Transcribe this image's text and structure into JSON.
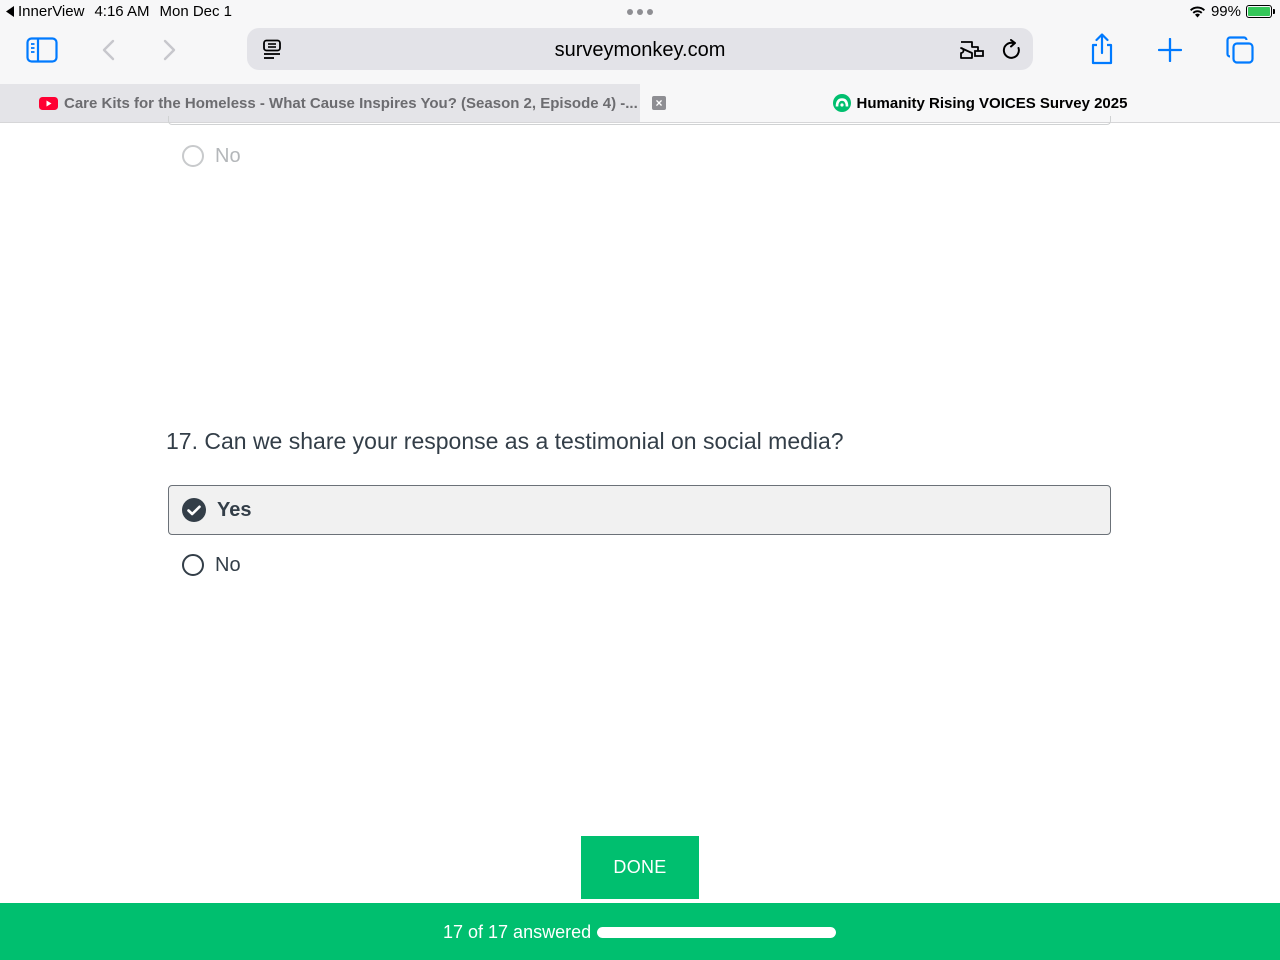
{
  "status_bar": {
    "back_app": "InnerView",
    "time": "4:16 AM",
    "date": "Mon Dec 1",
    "battery": "99%",
    "battery_level": 0.99
  },
  "browser": {
    "url": "surveymonkey.com",
    "icons": [
      "sidebar-icon",
      "back-icon",
      "forward-icon",
      "reader-icon",
      "extension-icon",
      "reload-icon",
      "share-icon",
      "new-tab-icon",
      "tabs-overview-icon"
    ]
  },
  "tabs": [
    {
      "title": "Care Kits for the Homeless - What Cause Inspires You? (Season 2, Episode 4) -...",
      "icon": "youtube-icon",
      "active": false
    },
    {
      "title": "Humanity Rising VOICES Survey 2025",
      "icon": "surveymonkey-icon",
      "active": true
    }
  ],
  "survey": {
    "previous_question": {
      "choice_no": "No"
    },
    "question": {
      "text": "17. Can we share your response as a testimonial on social media?",
      "choices": [
        {
          "label": "Yes",
          "selected": true
        },
        {
          "label": "No",
          "selected": false
        }
      ]
    },
    "done_button": "DONE",
    "progress": {
      "text": "17 of 17 answered",
      "fraction": 1.0
    }
  },
  "colors": {
    "brand_green": "#00bf6f",
    "text_dark": "#333e48",
    "ios_blue": "#007aff",
    "youtube_red": "#ff0033"
  }
}
